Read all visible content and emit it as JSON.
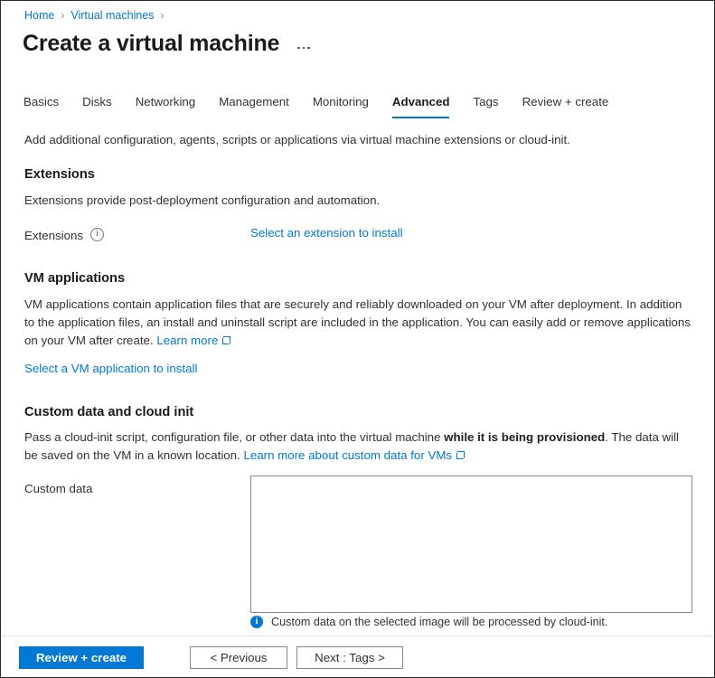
{
  "breadcrumb": {
    "items": [
      {
        "label": "Home"
      },
      {
        "label": "Virtual machines"
      }
    ],
    "separator": "›"
  },
  "header": {
    "title": "Create a virtual machine",
    "more_menu": "..."
  },
  "tabs": [
    {
      "label": "Basics",
      "active": false
    },
    {
      "label": "Disks",
      "active": false
    },
    {
      "label": "Networking",
      "active": false
    },
    {
      "label": "Management",
      "active": false
    },
    {
      "label": "Monitoring",
      "active": false
    },
    {
      "label": "Advanced",
      "active": true
    },
    {
      "label": "Tags",
      "active": false
    },
    {
      "label": "Review + create",
      "active": false
    }
  ],
  "main": {
    "intro": "Add additional configuration, agents, scripts or applications via virtual machine extensions or cloud-init.",
    "extensions": {
      "heading": "Extensions",
      "description": "Extensions provide post-deployment configuration and automation.",
      "field_label": "Extensions",
      "install_link": "Select an extension to install"
    },
    "vm_applications": {
      "heading": "VM applications",
      "description_part1": "VM applications contain application files that are securely and reliably downloaded on your VM after deployment. In addition to the application files, an install and uninstall script are included in the application. You can easily add or remove applications on your VM after create.",
      "learn_more": "Learn more",
      "install_link": "Select a VM application to install"
    },
    "custom_data": {
      "heading": "Custom data and cloud init",
      "description_part1": "Pass a cloud-init script, configuration file, or other data into the virtual machine ",
      "description_bold": "while it is being provisioned",
      "description_part2": ". The data will be saved on the VM in a known location. ",
      "learn_more": "Learn more about custom data for VMs",
      "field_label": "Custom data",
      "textarea_value": "",
      "note": "Custom data on the selected image will be processed by cloud-init."
    }
  },
  "footer": {
    "review_create": "Review + create",
    "previous": "< Previous",
    "next": "Next : Tags >"
  },
  "colors": {
    "accent": "#0078d4",
    "text": "#323130",
    "border": "#8a8886"
  }
}
